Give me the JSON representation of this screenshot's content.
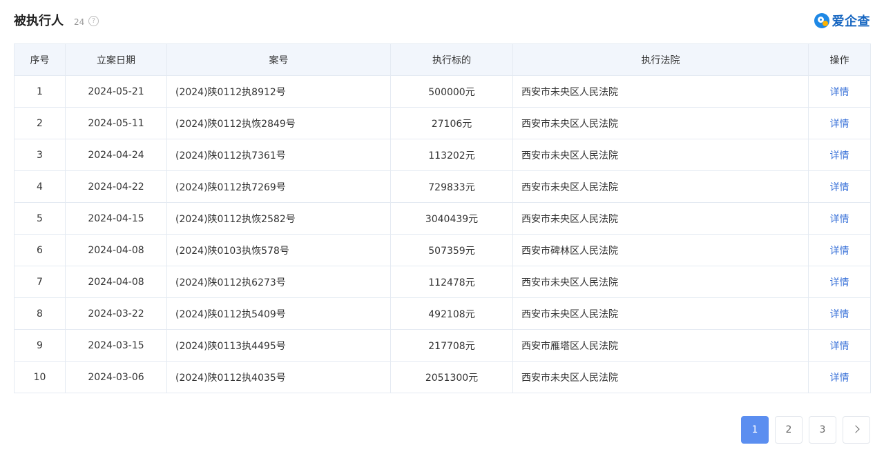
{
  "header": {
    "title": "被执行人",
    "count": "24",
    "help_glyph": "?",
    "logo_text": "爱企查",
    "logo_icon": "aiqicha-logo-icon"
  },
  "table": {
    "columns": [
      "序号",
      "立案日期",
      "案号",
      "执行标的",
      "执行法院",
      "操作"
    ],
    "rows": [
      {
        "no": "1",
        "date": "2024-05-21",
        "case": "(2024)陕0112执8912号",
        "amount": "500000元",
        "court": "西安市未央区人民法院",
        "action": "详情"
      },
      {
        "no": "2",
        "date": "2024-05-11",
        "case": "(2024)陕0112执恢2849号",
        "amount": "27106元",
        "court": "西安市未央区人民法院",
        "action": "详情"
      },
      {
        "no": "3",
        "date": "2024-04-24",
        "case": "(2024)陕0112执7361号",
        "amount": "113202元",
        "court": "西安市未央区人民法院",
        "action": "详情"
      },
      {
        "no": "4",
        "date": "2024-04-22",
        "case": "(2024)陕0112执7269号",
        "amount": "729833元",
        "court": "西安市未央区人民法院",
        "action": "详情"
      },
      {
        "no": "5",
        "date": "2024-04-15",
        "case": "(2024)陕0112执恢2582号",
        "amount": "3040439元",
        "court": "西安市未央区人民法院",
        "action": "详情"
      },
      {
        "no": "6",
        "date": "2024-04-08",
        "case": "(2024)陕0103执恢578号",
        "amount": "507359元",
        "court": "西安市碑林区人民法院",
        "action": "详情"
      },
      {
        "no": "7",
        "date": "2024-04-08",
        "case": "(2024)陕0112执6273号",
        "amount": "112478元",
        "court": "西安市未央区人民法院",
        "action": "详情"
      },
      {
        "no": "8",
        "date": "2024-03-22",
        "case": "(2024)陕0112执5409号",
        "amount": "492108元",
        "court": "西安市未央区人民法院",
        "action": "详情"
      },
      {
        "no": "9",
        "date": "2024-03-15",
        "case": "(2024)陕0113执4495号",
        "amount": "217708元",
        "court": "西安市雁塔区人民法院",
        "action": "详情"
      },
      {
        "no": "10",
        "date": "2024-03-06",
        "case": "(2024)陕0112执4035号",
        "amount": "2051300元",
        "court": "西安市未央区人民法院",
        "action": "详情"
      }
    ]
  },
  "pagination": {
    "pages": [
      "1",
      "2",
      "3"
    ],
    "current": "1",
    "next_icon": "chevron-right-icon"
  },
  "colors": {
    "link": "#3b73d9",
    "active_page": "#5b8ef0",
    "header_bg": "#f2f6fc"
  }
}
